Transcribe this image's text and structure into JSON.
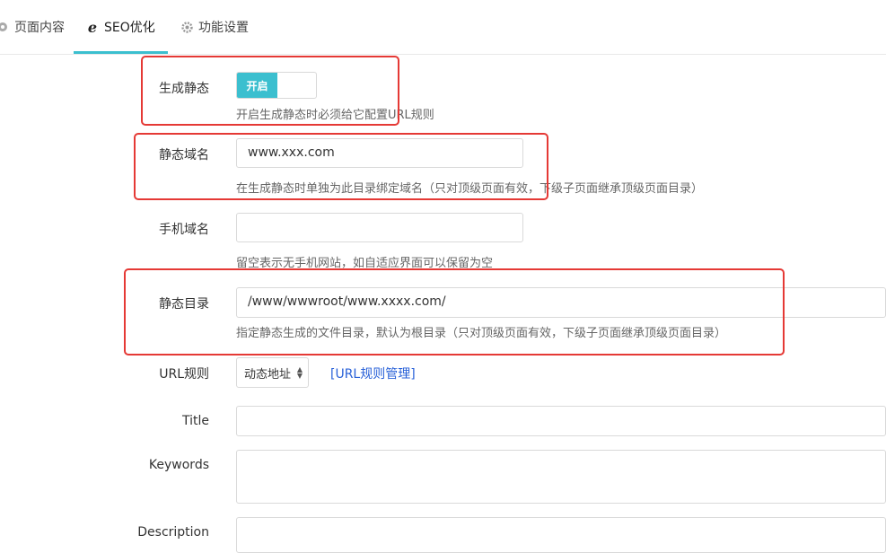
{
  "tabs": [
    {
      "label": "页面内容",
      "icon": "gear-icon"
    },
    {
      "label": "SEO优化",
      "icon": "ie-icon"
    },
    {
      "label": "功能设置",
      "icon": "gear-icon"
    }
  ],
  "form": {
    "static_gen": {
      "label": "生成静态",
      "switch_label": "开启",
      "help": "开启生成静态时必须给它配置URL规则"
    },
    "static_domain": {
      "label": "静态域名",
      "value": "www.xxx.com",
      "help": "在生成静态时单独为此目录绑定域名（只对顶级页面有效，下级子页面继承顶级页面目录）"
    },
    "mobile_domain": {
      "label": "手机域名",
      "value": "",
      "help": "留空表示无手机网站，如自适应界面可以保留为空"
    },
    "static_dir": {
      "label": "静态目录",
      "value": "/www/wwwroot/www.xxxx.com/",
      "help": "指定静态生成的文件目录，默认为根目录（只对顶级页面有效，下级子页面继承顶级页面目录）"
    },
    "url_rule": {
      "label": "URL规则",
      "selected": "动态地址",
      "link": "[URL规则管理]"
    },
    "title": {
      "label": "Title",
      "value": ""
    },
    "keywords": {
      "label": "Keywords",
      "value": ""
    },
    "description": {
      "label": "Description",
      "value": ""
    }
  },
  "colors": {
    "accent": "#3bbfcf",
    "highlight": "#e53935",
    "link": "#2a62d8"
  }
}
